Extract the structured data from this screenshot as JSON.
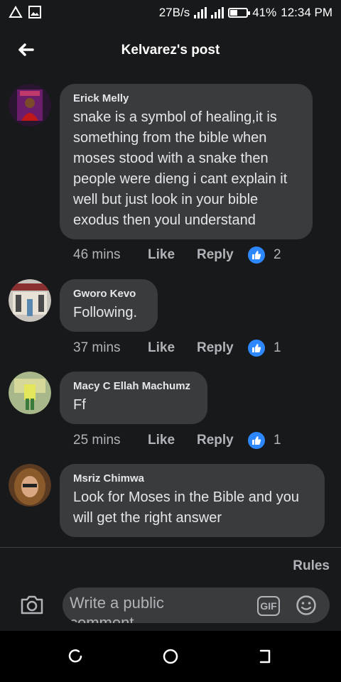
{
  "status": {
    "speed": "27B/s",
    "battery": "41%",
    "battery_level": 0.41,
    "time": "12:34 PM",
    "icons": [
      "alert-icon",
      "image-icon",
      "signal-icon",
      "battery-icon"
    ]
  },
  "header": {
    "title": "Kelvarez's post"
  },
  "comments": [
    {
      "author": "Erick Melly",
      "text": "snake is a symbol of healing,it is something from the bible when moses stood with a snake then people were dieng i cant explain it well but just look in your bible exodus then youl understand",
      "time": "46 mins",
      "like": "Like",
      "reply": "Reply",
      "reactions": "2"
    },
    {
      "author": "Gworo Kevo",
      "text": "Following.",
      "time": "37 mins",
      "like": "Like",
      "reply": "Reply",
      "reactions": "1"
    },
    {
      "author": "Macy C Ellah Machumz",
      "text": "Ff",
      "time": "25 mins",
      "like": "Like",
      "reply": "Reply",
      "reactions": "1"
    },
    {
      "author": "Msriz Chimwa",
      "text": "Look for Moses in the Bible and you will get the right answer"
    }
  ],
  "footer": {
    "rules": "Rules",
    "placeholder": "Write a public comment",
    "gif": "GIF"
  },
  "colors": {
    "background": "#18191a",
    "bubble": "#3a3b3c",
    "like_blue": "#2d88ff"
  }
}
